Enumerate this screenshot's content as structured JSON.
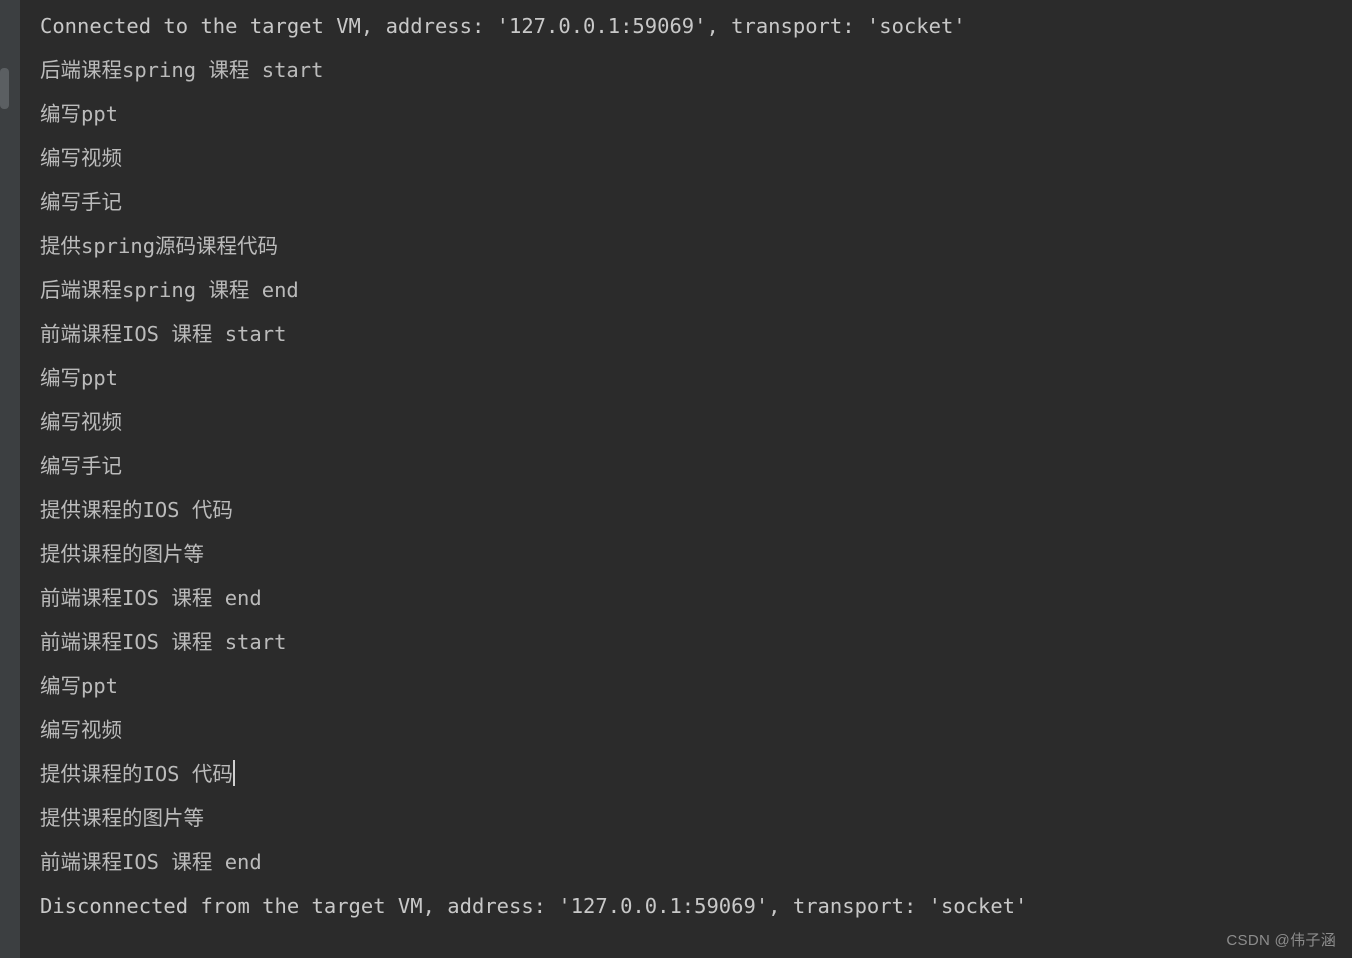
{
  "console": {
    "title": "Run console output",
    "lines": [
      {
        "text": "Connected to the target VM, address: '127.0.0.1:59069', transport: 'socket'",
        "kind": "system",
        "caret": false
      },
      {
        "text": "后端课程spring 课程 start",
        "kind": "output",
        "caret": false
      },
      {
        "text": "编写ppt",
        "kind": "output",
        "caret": false
      },
      {
        "text": "编写视频",
        "kind": "output",
        "caret": false
      },
      {
        "text": "编写手记",
        "kind": "output",
        "caret": false
      },
      {
        "text": "提供spring源码课程代码",
        "kind": "output",
        "caret": false
      },
      {
        "text": "后端课程spring 课程 end",
        "kind": "output",
        "caret": false
      },
      {
        "text": "前端课程IOS 课程 start",
        "kind": "output",
        "caret": false
      },
      {
        "text": "编写ppt",
        "kind": "output",
        "caret": false
      },
      {
        "text": "编写视频",
        "kind": "output",
        "caret": false
      },
      {
        "text": "编写手记",
        "kind": "output",
        "caret": false
      },
      {
        "text": "提供课程的IOS 代码",
        "kind": "output",
        "caret": false
      },
      {
        "text": "提供课程的图片等",
        "kind": "output",
        "caret": false
      },
      {
        "text": "前端课程IOS 课程 end",
        "kind": "output",
        "caret": false
      },
      {
        "text": "前端课程IOS 课程 start",
        "kind": "output",
        "caret": false
      },
      {
        "text": "编写ppt",
        "kind": "output",
        "caret": false
      },
      {
        "text": "编写视频",
        "kind": "output",
        "caret": false
      },
      {
        "text": "提供课程的IOS 代码",
        "kind": "output",
        "caret": true
      },
      {
        "text": "提供课程的图片等",
        "kind": "output",
        "caret": false
      },
      {
        "text": "前端课程IOS 课程 end",
        "kind": "output",
        "caret": false
      },
      {
        "text": "Disconnected from the target VM, address: '127.0.0.1:59069', transport: 'socket'",
        "kind": "system",
        "caret": false
      }
    ]
  },
  "scrollbars": {
    "vertical_thumb_label": "vertical-scrollbar-thumb",
    "horizontal_thumb_label": "horizontal-scrollbar-thumb"
  },
  "watermark": {
    "text": "CSDN @伟子涵"
  },
  "colors": {
    "background": "#2b2b2b",
    "gutter": "#3c3f41",
    "text": "#bbbbbb",
    "system_text": "#c8c8c8",
    "scrollbar_thumb": "#5b5f62",
    "caret": "#d0d0d0",
    "watermark": "#8d8d8d"
  }
}
